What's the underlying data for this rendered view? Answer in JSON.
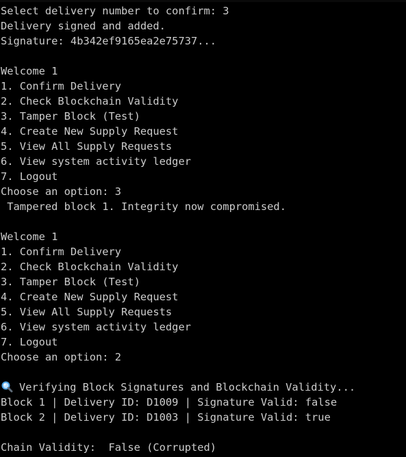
{
  "terminal": {
    "lines": [
      "Select delivery number to confirm: 3",
      "Delivery signed and added.",
      "Signature: 4b342ef9165ea2e75737...",
      "",
      "Welcome 1",
      "1. Confirm Delivery",
      "2. Check Blockchain Validity",
      "3. Tamper Block (Test)",
      "4. Create New Supply Request",
      "5. View All Supply Requests",
      "6. View system activity ledger",
      "7. Logout",
      "Choose an option: 3",
      " Tampered block 1. Integrity now compromised.",
      "",
      "Welcome 1",
      "1. Confirm Delivery",
      "2. Check Blockchain Validity",
      "3. Tamper Block (Test)",
      "4. Create New Supply Request",
      "5. View All Supply Requests",
      "6. View system activity ledger",
      "7. Logout",
      "Choose an option: 2",
      "",
      "Verifying Block Signatures and Blockchain Validity...",
      "Block 1 | Delivery ID: D1009 | Signature Valid: false",
      "Block 2 | Delivery ID: D1003 | Signature Valid: true",
      "",
      "Chain Validity:  False (Corrupted)"
    ],
    "verify_icon": "magnifying-glass-icon",
    "colors": {
      "background": "#000000",
      "text": "#cccccc",
      "icon": "#4a9fe0"
    }
  }
}
